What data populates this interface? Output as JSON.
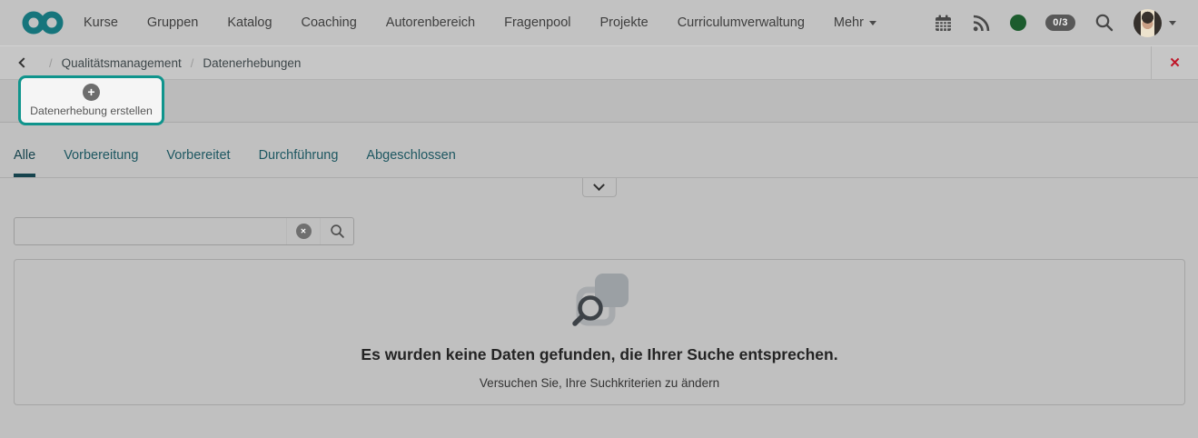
{
  "navbar": {
    "items": [
      "Kurse",
      "Gruppen",
      "Katalog",
      "Coaching",
      "Autorenbereich",
      "Fragenpool",
      "Projekte",
      "Curriculumverwaltung"
    ],
    "more_label": "Mehr",
    "session_badge": "0/3"
  },
  "breadcrumb": {
    "separator": "/",
    "items": [
      "Qualitätsmanagement",
      "Datenerhebungen"
    ]
  },
  "toolbar": {
    "create_button_label": "Datenerhebung erstellen"
  },
  "tabs": {
    "items": [
      {
        "label": "Alle",
        "active": true
      },
      {
        "label": "Vorbereitung",
        "active": false
      },
      {
        "label": "Vorbereitet",
        "active": false
      },
      {
        "label": "Durchführung",
        "active": false
      },
      {
        "label": "Abgeschlossen",
        "active": false
      }
    ]
  },
  "search": {
    "value": "",
    "placeholder": ""
  },
  "empty_state": {
    "title": "Es wurden keine Daten gefunden, die Ihrer Suche entsprechen.",
    "subtitle": "Versuchen Sie, Ihre Suchkriterien zu ändern"
  },
  "icons": {
    "plus_glyph": "+",
    "close_glyph": "✕",
    "clear_glyph": "✕"
  },
  "colors": {
    "accent_teal": "#16757c",
    "highlight_teal": "#0f948c",
    "tab_link_teal": "#1d5761",
    "tab_active_teal": "#16434d",
    "close_red": "#bf1628",
    "status_green": "#1c5c2e",
    "page_background": "#c0c0c0"
  }
}
